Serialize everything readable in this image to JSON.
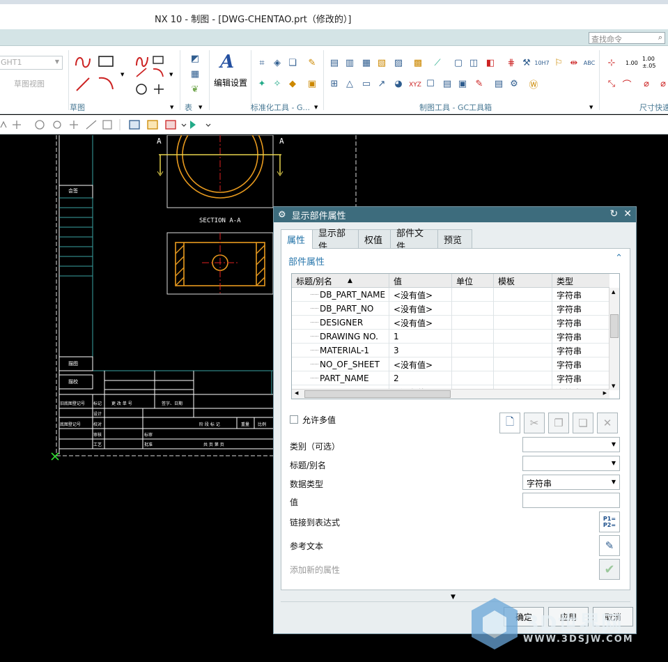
{
  "window": {
    "title": "NX 10 - 制图 - [DWG-CHENTAO.prt（修改的）]"
  },
  "search": {
    "placeholder": "查找命令"
  },
  "ribbon": {
    "view_combo": "GHT1",
    "sketch_view_label": "草图视图",
    "groups": {
      "sketch": "草图",
      "table": "表",
      "std_tools": "标准化工具 - G...",
      "drafting_tools": "制图工具 - GC工具箱",
      "dimension_quick": "尺寸快速"
    },
    "edit_settings": "编辑设置",
    "dim_labels": [
      "1.00",
      "1.00",
      "±.05"
    ]
  },
  "drawing": {
    "section_marker_left": "A",
    "section_marker_right": "A",
    "section_label": "SECTION A-A",
    "title_block": {
      "r1": "会签",
      "r2": "描图",
      "r3": "描校",
      "r4": [
        "旧底图登记号",
        "标记",
        "更 改 单 号",
        "签字、日期"
      ],
      "r5": "设计",
      "r6": [
        "底图登记号",
        "校对",
        "阶 段 标 记",
        "重量",
        "比例"
      ],
      "r7": [
        "审核",
        "标审"
      ],
      "r8": [
        "工艺",
        "批准",
        "共 页 第 页"
      ]
    }
  },
  "dialog": {
    "title": "显示部件属性",
    "tabs": [
      "属性",
      "显示部件",
      "权值",
      "部件文件",
      "预览"
    ],
    "section_title": "部件属性",
    "table": {
      "headers": [
        "标题/别名",
        "值",
        "单位",
        "模板",
        "类型"
      ],
      "rows": [
        {
          "name": "DB_PART_NAME",
          "value": "<没有值>",
          "type": "字符串"
        },
        {
          "name": "DB_PART_NO",
          "value": "<没有值>",
          "type": "字符串"
        },
        {
          "name": "DESIGNER",
          "value": "<没有值>",
          "type": "字符串"
        },
        {
          "name": "DRAWING NO.",
          "value": "1",
          "type": "字符串"
        },
        {
          "name": "MATERIAL-1",
          "value": "3",
          "type": "字符串"
        },
        {
          "name": "NO_OF_SHEET",
          "value": "<没有值>",
          "type": "字符串"
        },
        {
          "name": "PART_NAME",
          "value": "2",
          "type": "字符串"
        },
        {
          "name": "SCALE",
          "value": "<没有值>",
          "type": "字符串"
        }
      ]
    },
    "allow_multi": "允许多值",
    "category_label": "类别（可选）",
    "title_alias_label": "标题/别名",
    "data_type_label": "数据类型",
    "data_type_value": "字符串",
    "value_label": "值",
    "link_expr_label": "链接到表达式",
    "ref_text_label": "参考文本",
    "add_new_label": "添加新的属性",
    "ok": "确定",
    "apply": "应用",
    "cancel": "取消"
  },
  "watermark": {
    "name": "3D世界网",
    "url": "WWW.3DSJW.COM"
  }
}
